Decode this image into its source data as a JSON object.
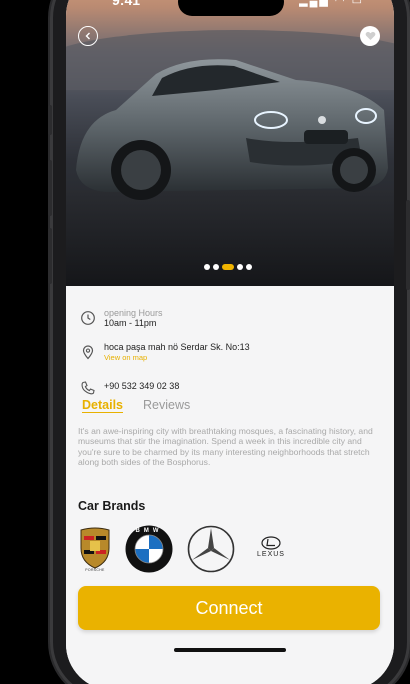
{
  "status": {
    "time": "9:41"
  },
  "hero": {
    "slides_total": 5,
    "active_slide": 3
  },
  "info": {
    "hours_label": "opening Hours",
    "hours_value": "10am - 11pm",
    "address": "hoca paşa mah nö Serdar Sk. No:13",
    "map_link": "View on map",
    "phone": "+90 532 349 02 38"
  },
  "tabs": [
    {
      "label": "Details",
      "active": true
    },
    {
      "label": "Reviews",
      "active": false
    }
  ],
  "description": "It's an awe-inspiring city with breathtaking mosques, a fascinating history, and museums that stir the imagination. Spend a week in this incredible city and you're sure to be charmed by its many interesting neighborhoods that stretch along both sides of the Bosphorus.",
  "brands_title": "Car Brands",
  "brands": [
    {
      "icon": "porsche-logo-icon",
      "label": "PORSCHE"
    },
    {
      "icon": "bmw-logo-icon",
      "label": "BMW"
    },
    {
      "icon": "mercedes-logo-icon",
      "label": ""
    },
    {
      "icon": "lexus-logo-icon",
      "label": "LEXUS"
    }
  ],
  "connect_label": "Connect",
  "colors": {
    "accent": "#eab200",
    "background": "#f5f5f6"
  }
}
